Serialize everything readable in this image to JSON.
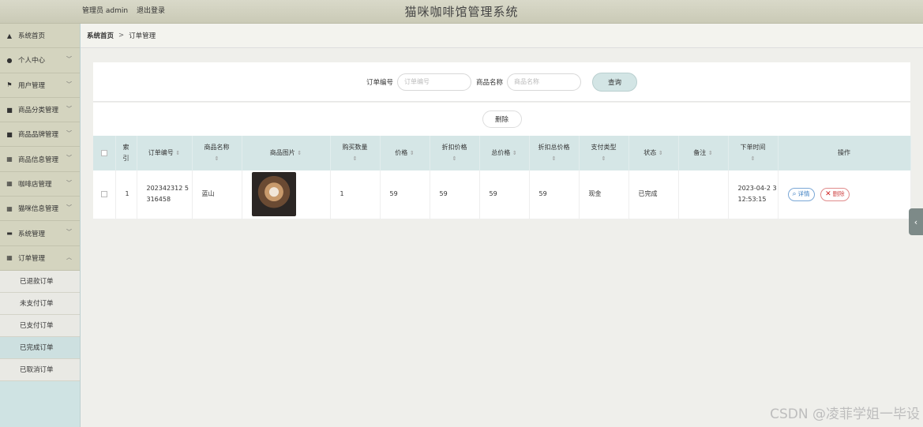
{
  "header": {
    "user_label": "管理员 admin",
    "logout_label": "退出登录",
    "system_title": "猫咪咖啡馆管理系统"
  },
  "sidebar": {
    "items": [
      {
        "label": "系统首页",
        "icon": "home-icon"
      },
      {
        "label": "个人中心",
        "icon": "user-icon"
      },
      {
        "label": "用户管理",
        "icon": "flag-icon"
      },
      {
        "label": "商品分类管理",
        "icon": "box-icon"
      },
      {
        "label": "商品品牌管理",
        "icon": "box-icon"
      },
      {
        "label": "商品信息管理",
        "icon": "grid-icon"
      },
      {
        "label": "咖啡店管理",
        "icon": "grid-icon"
      },
      {
        "label": "猫咪信息管理",
        "icon": "grid-icon"
      },
      {
        "label": "系统管理",
        "icon": "message-icon"
      },
      {
        "label": "订单管理",
        "icon": "grid-icon"
      }
    ],
    "order_sub_items": [
      {
        "label": "已退款订单"
      },
      {
        "label": "未支付订单"
      },
      {
        "label": "已支付订单"
      },
      {
        "label": "已完成订单"
      },
      {
        "label": "已取消订单"
      }
    ]
  },
  "breadcrumb": {
    "home": "系统首页",
    "separator": ">",
    "current": "订单管理"
  },
  "search": {
    "order_no_label": "订单编号",
    "order_no_placeholder": "订单编号",
    "product_name_label": "商品名称",
    "product_name_placeholder": "商品名称",
    "search_button": "查询"
  },
  "actions": {
    "delete_button": "删除"
  },
  "table": {
    "headers": {
      "index": "索\n引",
      "order_no": "订单编号",
      "product_name": "商品名称",
      "product_image": "商品图片",
      "quantity": "购买数量",
      "price": "价格",
      "discount_price": "折扣价格",
      "total_price": "总价格",
      "discount_total": "折扣总价格",
      "pay_type": "支付类型",
      "status": "状态",
      "remark": "备注",
      "order_time": "下单时间",
      "operation": "操作"
    },
    "rows": [
      {
        "index": "1",
        "order_no": "202342312 5316458",
        "product_name": "蓝山",
        "quantity": "1",
        "price": "59",
        "discount_price": "59",
        "total_price": "59",
        "discount_total": "59",
        "pay_type": "现金",
        "status": "已完成",
        "remark": "",
        "order_time": "2023-04-2 3 12:53:15",
        "detail_label": "详情",
        "delete_label": "删除"
      }
    ]
  },
  "watermark": "CSDN @凌菲学姐一毕设",
  "colors": {
    "header_bg": "#d9d9c9",
    "sidebar_bg": "#cfe3e3",
    "table_header_bg": "#d5e6e6",
    "detail_blue": "#3e7fc2",
    "delete_red": "#d14b4b"
  }
}
